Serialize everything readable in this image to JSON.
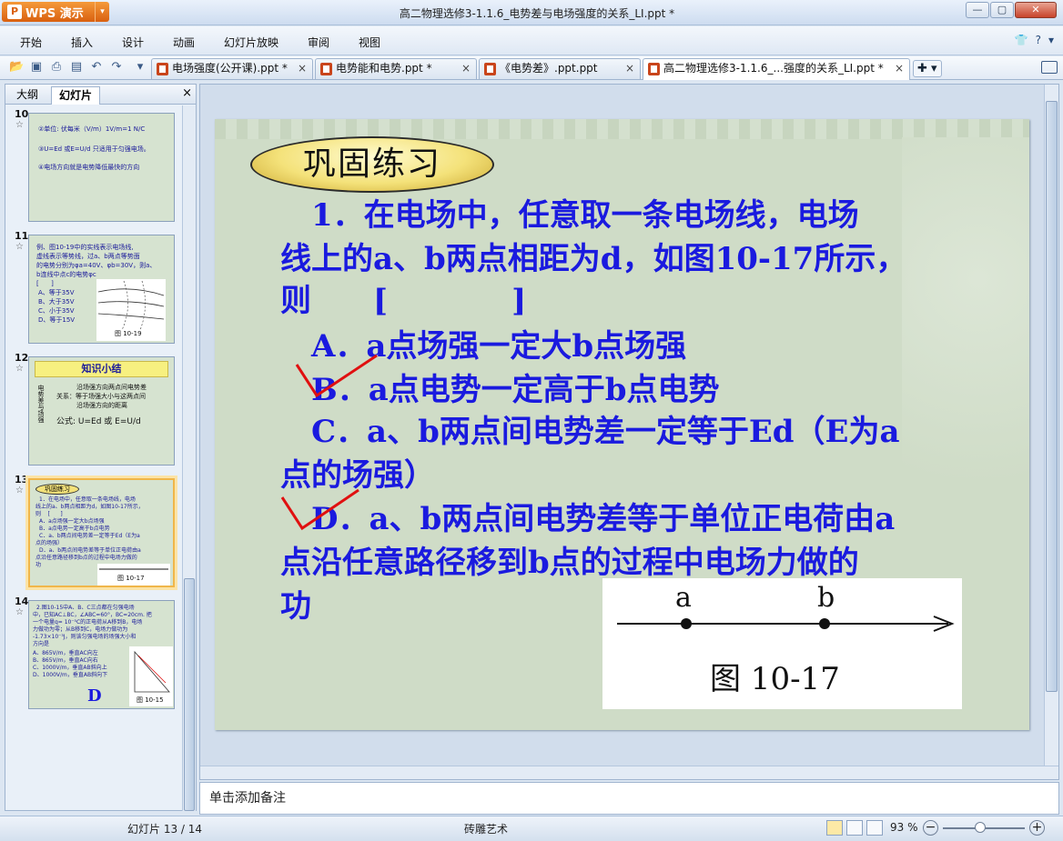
{
  "app": {
    "name": "WPS 演示",
    "logo_letter": "P",
    "dropdown": "▾"
  },
  "window": {
    "title": "高二物理选修3-1.1.6_电势差与电场强度的关系_LI.ppt *",
    "min": "—",
    "max": "▢",
    "close": "✕"
  },
  "menu": [
    "开始",
    "插入",
    "设计",
    "动画",
    "幻灯片放映",
    "审阅",
    "视图"
  ],
  "menu_right": {
    "skin_icon": "👕",
    "help": "?",
    "help_drop": "▾"
  },
  "toolbar_icons": [
    "folder-icon",
    "save-icon",
    "print-icon",
    "print-preview-icon",
    "undo-icon",
    "redo-icon",
    "toolbar-dropdown-icon"
  ],
  "tabs": [
    {
      "label": "电场强度(公开课).ppt *",
      "active": false
    },
    {
      "label": "电势能和电势.ppt *",
      "active": false
    },
    {
      "label": "《电势差》.ppt.ppt",
      "active": false
    },
    {
      "label": "高二物理选修3-1.1.6_...强度的关系_LI.ppt *",
      "active": true
    }
  ],
  "tab_close": "×",
  "tab_add": "✚ ▾",
  "left_panel": {
    "tab_outline": "大纲",
    "tab_slides": "幻灯片",
    "close": "×",
    "thumbs": [
      {
        "num": "10",
        "lines": [
          "②单位: 伏每米（V/m）1V/m=1 N/C",
          "③U=Ed 或E=U/d 只适用于匀强电场。",
          "④电场方向就是电势降低最快的方向"
        ]
      },
      {
        "num": "11",
        "lines": [
          "例、图10-19中的实线表示电场线,",
          "虚线表示等势线，过a、b两点等势面",
          "的电势分别为φa=40V、φb=30V，则a、",
          "b连线中点c的电势φc",
          "[      ]",
          "A、等于35V",
          "B、大于35V",
          "C、小于35V",
          "D、等于15V"
        ],
        "caption": "图 10-19"
      },
      {
        "num": "12",
        "title": "知识小结",
        "lines": [
          "沿场强方向两点间电势差",
          "关系：等于场强大小与这两点间",
          "沿场强方向的距离",
          "公式: U=Ed 或 E=U/d"
        ],
        "side": "电势差与场强"
      },
      {
        "num": "13",
        "title": "巩固练习",
        "lines": [
          "1．在电场中，任意取一条电场线，电场",
          "线上的a、b两点相距为d，如图10-17所示，",
          "则    [      ]",
          "A．a点场强一定大b点场强",
          "B．a点电势一定高于b点电势",
          "C．a、b两点间电势差一定等于Ed（E为a",
          "点的场强）",
          "D．a、b两点间电势差等于单位正电荷由a",
          "点沿任意路径移到b点的过程中电场力做的",
          "功"
        ],
        "caption": "图 10-17"
      },
      {
        "num": "14",
        "lines": [
          "2.图10-15中A、B、C三点都在匀强电场",
          "中，已知AC⊥BC，∠ABC=60°，BC=20cm. 把",
          "一个电量q= 10⁻⁵C的正电荷从A移到B，电场",
          "力做功为零；从B移到C，电场力做功为",
          "-1.73×10⁻³J，则该匀强电场的场强大小和",
          "方向是",
          "A、865V/m，垂直AC向左",
          "B、865V/m，垂直AC向右",
          "C、1000V/m，垂直AB斜向上",
          "D、1000V/m，垂直AB斜向下"
        ],
        "caption": "图 10-15",
        "answer": "D"
      }
    ],
    "star": "☆"
  },
  "slide": {
    "title": "巩固练习",
    "lines": [
      "　1．在电场中，任意取一条电场线，电场",
      "线上的a、b两点相距为d，如图10-17所示，",
      "则　　[　　　　]",
      "　A．a点场强一定大b点场强",
      "　B．a点电势一定高于b点电势",
      "　C．a、b两点间电势差一定等于Ed（E为a",
      "点的场强）",
      "　D．a、b两点间电势差等于单位正电荷由a",
      "点沿任意路径移到b点的过程中电场力做的",
      "功"
    ],
    "figure": {
      "label_a": "a",
      "label_b": "b",
      "caption": "图 10-17"
    }
  },
  "notes": {
    "placeholder": "单击添加备注"
  },
  "status": {
    "slide_indicator": "幻灯片 13 / 14",
    "theme": "砖雕艺术",
    "zoom": "93 %",
    "zoom_level_percent": 93,
    "zoom_minus": "−",
    "zoom_plus": "+"
  },
  "colors": {
    "slide_text": "#1a1adf",
    "check_mark": "#e01010",
    "app_button": "#e8771f",
    "slide_bg": "#cfdcc7"
  }
}
